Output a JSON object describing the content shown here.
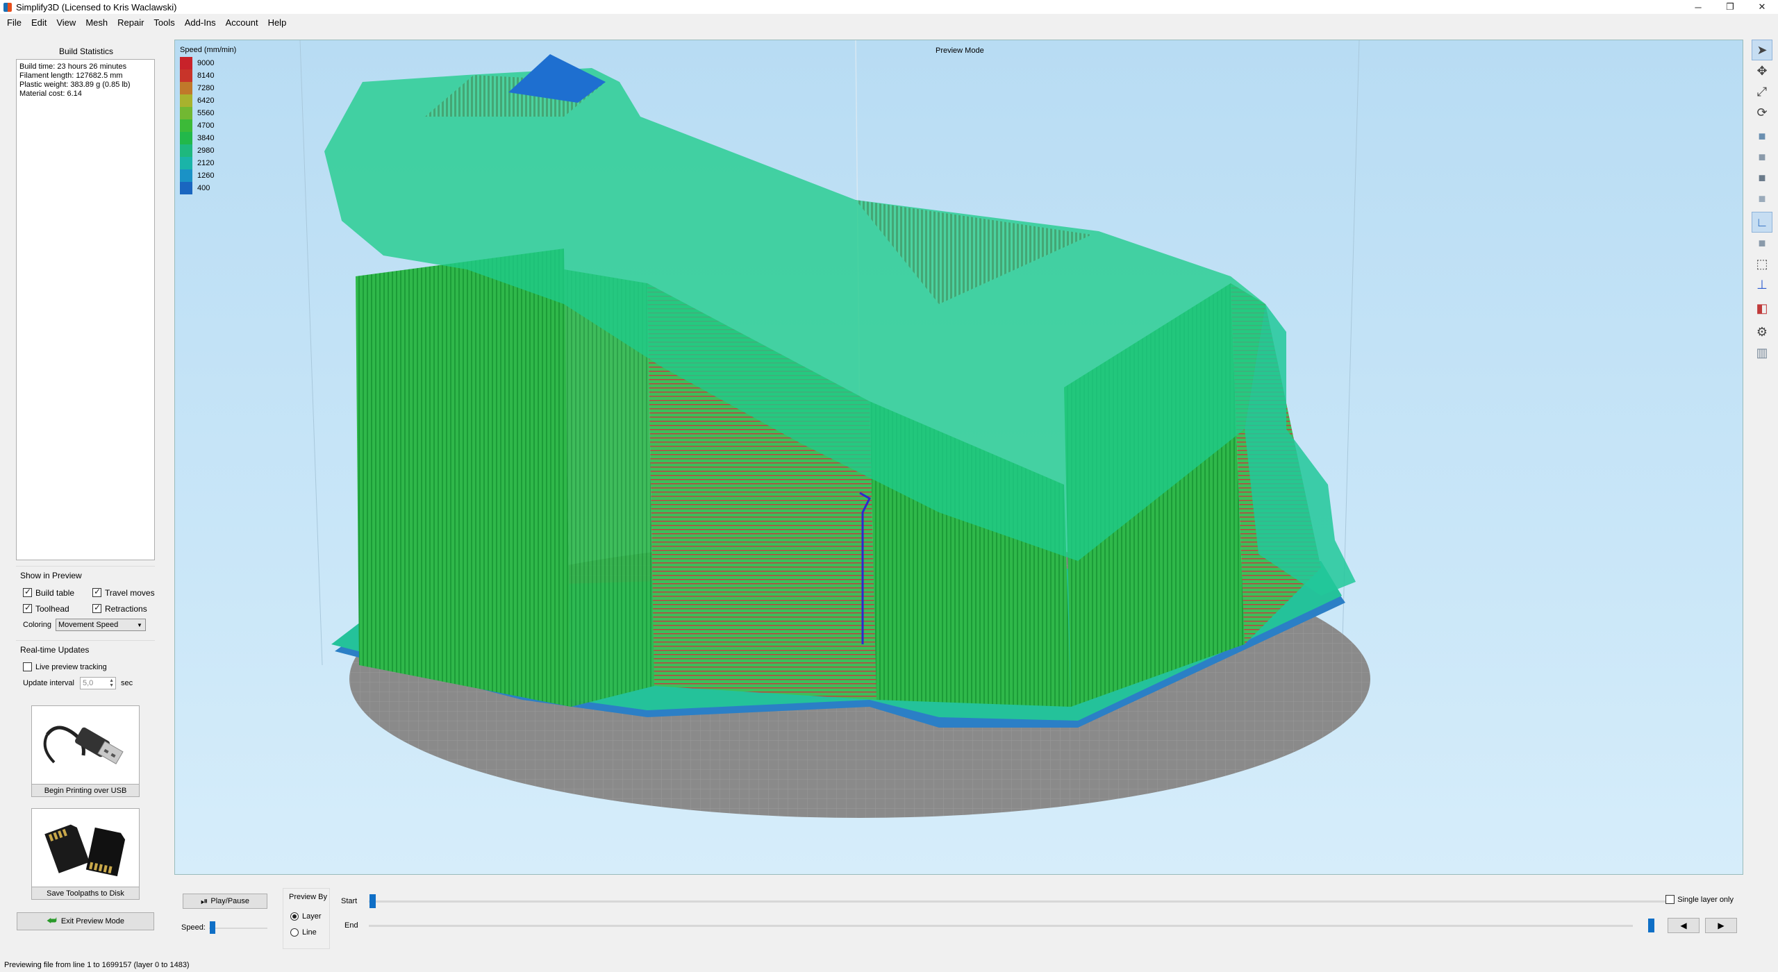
{
  "window": {
    "title": "Simplify3D (Licensed to Kris Waclawski)",
    "controls": [
      "─",
      "❐",
      "✕"
    ]
  },
  "menu": [
    "File",
    "Edit",
    "View",
    "Mesh",
    "Repair",
    "Tools",
    "Add-Ins",
    "Account",
    "Help"
  ],
  "build_stats": {
    "title": "Build Statistics",
    "lines": [
      "Build time: 23 hours 26 minutes",
      "Filament length: 127682.5 mm",
      "Plastic weight: 383.89 g (0.85 lb)",
      "Material cost: 6.14"
    ]
  },
  "show_in_preview": {
    "title": "Show in Preview",
    "build_table": {
      "label": "Build table",
      "checked": true
    },
    "travel_moves": {
      "label": "Travel moves",
      "checked": true
    },
    "toolhead": {
      "label": "Toolhead",
      "checked": true
    },
    "retractions": {
      "label": "Retractions",
      "checked": true
    },
    "coloring_label": "Coloring",
    "coloring_value": "Movement Speed"
  },
  "realtime": {
    "title": "Real-time Updates",
    "live_tracking_label": "Live preview tracking",
    "live_tracking_checked": false,
    "interval_label": "Update interval",
    "interval_value": "5,0",
    "interval_unit": "sec"
  },
  "buttons": {
    "usb": "Begin Printing over USB",
    "save": "Save Toolpaths to Disk",
    "exit": "Exit Preview Mode",
    "play": "Play/Pause",
    "prev": "◀",
    "next": "▶"
  },
  "viewport": {
    "mode_label": "Preview Mode",
    "legend_title": "Speed (mm/min)",
    "legend": [
      {
        "label": "9000",
        "color": "#c8222a"
      },
      {
        "label": "8140",
        "color": "#c8342a"
      },
      {
        "label": "7280",
        "color": "#c0782a"
      },
      {
        "label": "6420",
        "color": "#a8b22e"
      },
      {
        "label": "5560",
        "color": "#72b832"
      },
      {
        "label": "4700",
        "color": "#3cba38"
      },
      {
        "label": "3840",
        "color": "#22b84a"
      },
      {
        "label": "2980",
        "color": "#1eb87e"
      },
      {
        "label": "2120",
        "color": "#1ab4a8"
      },
      {
        "label": "1260",
        "color": "#1a92c6"
      },
      {
        "label": "400",
        "color": "#1a66c0"
      }
    ]
  },
  "toolbar_icons": [
    "select-icon",
    "move-icon",
    "scale-icon",
    "rotate-icon",
    "view-front-icon",
    "view-top-icon",
    "view-left-icon",
    "view-right-icon",
    "axes-icon",
    "solid-view-icon",
    "wireframe-icon",
    "normals-icon",
    "cross-section-icon",
    "settings-icon",
    "build-table-icon"
  ],
  "playback": {
    "speed_label": "Speed:",
    "speed_fraction": 0.05,
    "preview_by_title": "Preview By",
    "layer_label": "Layer",
    "line_label": "Line",
    "preview_by": "layer",
    "start_label": "Start",
    "end_label": "End",
    "start_fraction": 0.0,
    "end_fraction": 1.0,
    "single_layer_label": "Single layer only",
    "single_layer_checked": false
  },
  "status": "Previewing file from line 1 to 1699157 (layer 0 to 1483)"
}
